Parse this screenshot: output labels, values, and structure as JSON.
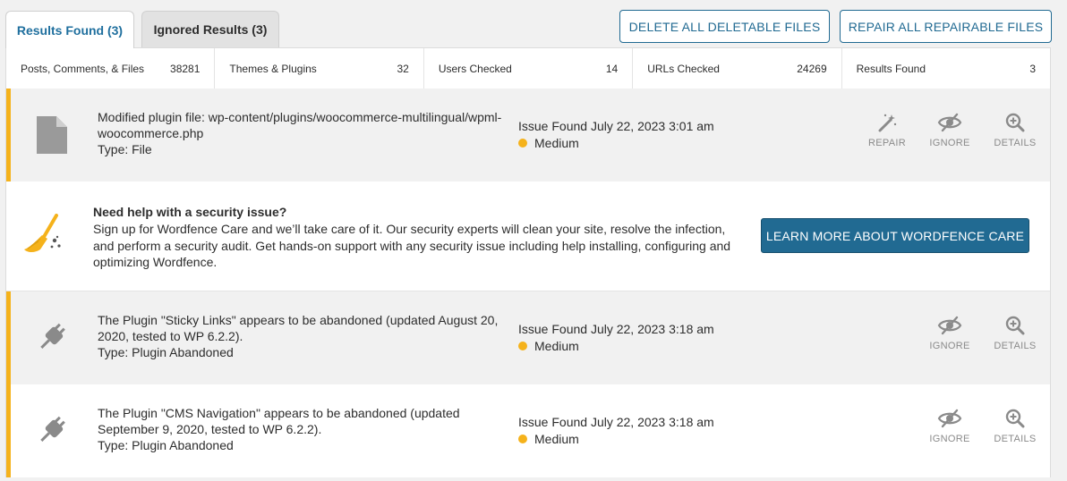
{
  "tabs": {
    "results": "Results Found (3)",
    "ignored": "Ignored Results (3)"
  },
  "actions": {
    "delete_all": "DELETE ALL DELETABLE FILES",
    "repair_all": "REPAIR ALL REPAIRABLE FILES"
  },
  "stats": [
    {
      "label": "Posts, Comments, & Files",
      "value": "38281"
    },
    {
      "label": "Themes & Plugins",
      "value": "32"
    },
    {
      "label": "Users Checked",
      "value": "14"
    },
    {
      "label": "URLs Checked",
      "value": "24269"
    },
    {
      "label": "Results Found",
      "value": "3"
    }
  ],
  "issues": [
    {
      "title": "Modified plugin file: wp-content/plugins/woocommerce-multilingual/wpml-woocommerce.php",
      "type": "Type: File",
      "found": "Issue Found July 22, 2023 3:01 am",
      "severity": "Medium",
      "icon": "file-icon",
      "repair_label": "REPAIR",
      "ignore_label": "IGNORE",
      "details_label": "DETAILS"
    },
    {
      "title": "The Plugin \"Sticky Links\" appears to be abandoned (updated August 20, 2020, tested to WP 6.2.2).",
      "type": "Type: Plugin Abandoned",
      "found": "Issue Found July 22, 2023 3:18 am",
      "severity": "Medium",
      "icon": "plug-icon",
      "ignore_label": "IGNORE",
      "details_label": "DETAILS"
    },
    {
      "title": "The Plugin \"CMS Navigation\" appears to be abandoned (updated September 9, 2020, tested to WP 6.2.2).",
      "type": "Type: Plugin Abandoned",
      "found": "Issue Found July 22, 2023 3:18 am",
      "severity": "Medium",
      "icon": "plug-icon",
      "ignore_label": "IGNORE",
      "details_label": "DETAILS"
    }
  ],
  "care": {
    "title": "Need help with a security issue?",
    "body": "Sign up for Wordfence Care and we’ll take care of it. Our security experts will clean your site, resolve the infection, and perform a security audit. Get hands-on support with any security issue including help installing, configuring and optimizing Wordfence.",
    "button": "LEARN MORE ABOUT WORDFENCE CARE",
    "icon": "broom-icon"
  },
  "colors": {
    "accent": "#216a92",
    "tab_active_text": "#1f6f9e",
    "severity_medium": "#f5b21b",
    "icon_gray": "#8a8a8a"
  }
}
